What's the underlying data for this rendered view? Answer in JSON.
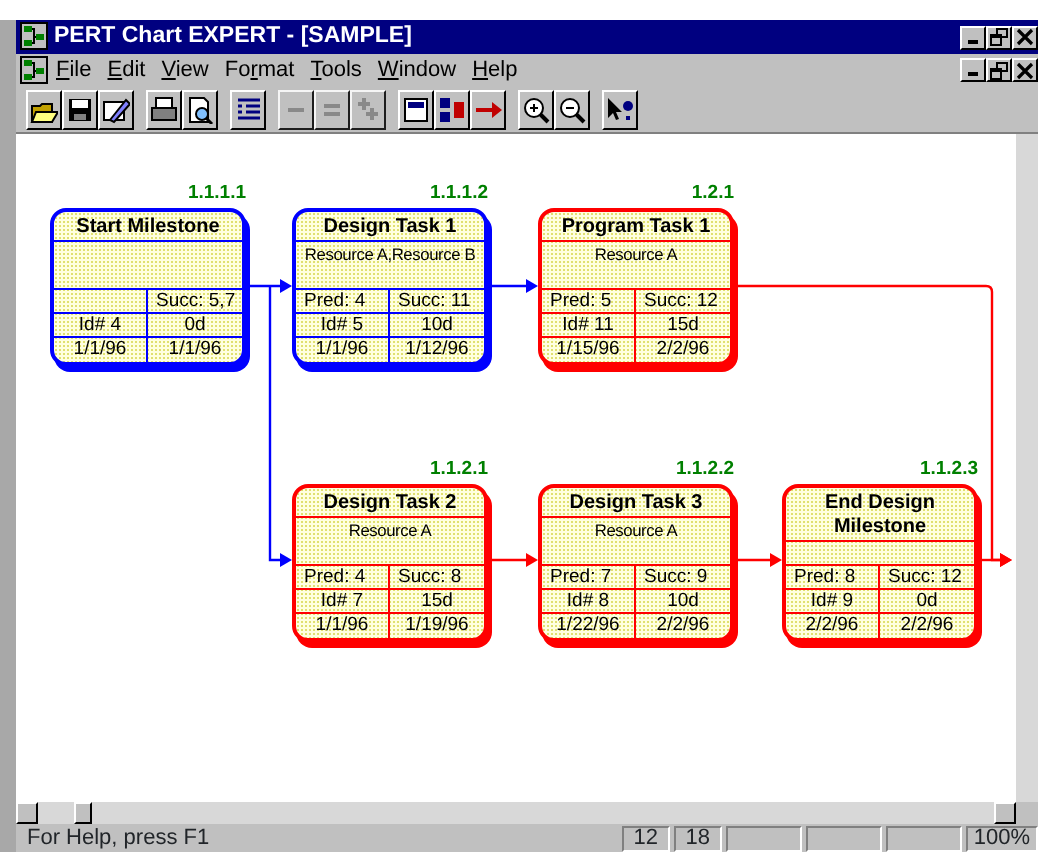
{
  "window": {
    "title": "PERT Chart EXPERT - [SAMPLE]"
  },
  "menu": [
    {
      "key": "F",
      "after": "ile"
    },
    {
      "key": "E",
      "after": "dit"
    },
    {
      "key": "V",
      "after": "iew"
    },
    {
      "before": "Fo",
      "key": "r",
      "after": "mat"
    },
    {
      "key": "T",
      "after": "ools"
    },
    {
      "key": "W",
      "after": "indow"
    },
    {
      "key": "H",
      "after": "elp"
    }
  ],
  "toolbar": [
    [
      {
        "kind": "open",
        "disabled": false
      },
      {
        "kind": "save",
        "disabled": false
      },
      {
        "kind": "edit",
        "disabled": false
      }
    ],
    [
      {
        "kind": "print",
        "disabled": false
      },
      {
        "kind": "preview",
        "disabled": false
      }
    ],
    [
      {
        "kind": "outline",
        "disabled": false
      }
    ],
    [
      {
        "kind": "minus",
        "disabled": true
      },
      {
        "kind": "minus2",
        "disabled": true
      },
      {
        "kind": "plus",
        "disabled": true
      }
    ],
    [
      {
        "kind": "box",
        "disabled": false
      },
      {
        "kind": "spell",
        "disabled": false
      },
      {
        "kind": "arrow",
        "disabled": false
      }
    ],
    [
      {
        "kind": "zoomin",
        "disabled": false
      },
      {
        "kind": "zoomout",
        "disabled": false
      }
    ],
    [
      {
        "kind": "help",
        "disabled": false
      }
    ]
  ],
  "nodes": [
    {
      "wbs": "1.1.1.1",
      "title": "Start Milestone",
      "succ": "Succ: 5,7",
      "id": "Id# 4",
      "duration": "0d",
      "start": "1/1/96",
      "finish": "1/1/96",
      "color": "#0000ff"
    },
    {
      "wbs": "1.1.1.2",
      "title": "Design Task 1",
      "resource": "Resource A,Resource B",
      "pred": "Pred: 4",
      "succ": "Succ: 11",
      "id": "Id# 5",
      "duration": "10d",
      "start": "1/1/96",
      "finish": "1/12/96",
      "color": "#0000ff"
    },
    {
      "wbs": "1.2.1",
      "title": "Program Task 1",
      "resource": "Resource A",
      "pred": "Pred: 5",
      "succ": "Succ: 12",
      "id": "Id# 11",
      "duration": "15d",
      "start": "1/15/96",
      "finish": "2/2/96",
      "color": "#ff0000"
    },
    {
      "wbs": "1.1.2.1",
      "title": "Design Task 2",
      "resource": "Resource A",
      "pred": "Pred: 4",
      "succ": "Succ: 8",
      "id": "Id# 7",
      "duration": "15d",
      "start": "1/1/96",
      "finish": "1/19/96",
      "color": "#ff0000"
    },
    {
      "wbs": "1.1.2.2",
      "title": "Design Task 3",
      "resource": "Resource A",
      "pred": "Pred: 7",
      "succ": "Succ: 9",
      "id": "Id# 8",
      "duration": "10d",
      "start": "1/22/96",
      "finish": "2/2/96",
      "color": "#ff0000"
    },
    {
      "wbs": "1.1.2.3",
      "title": "End Design Milestone",
      "pred": "Pred: 8",
      "succ": "Succ: 12",
      "id": "Id# 9",
      "duration": "0d",
      "start": "2/2/96",
      "finish": "2/2/96",
      "color": "#ff0000"
    }
  ],
  "status_bar": {
    "message": "For Help, press F1",
    "panels": [
      "12",
      "18"
    ],
    "zoom": "100%"
  }
}
